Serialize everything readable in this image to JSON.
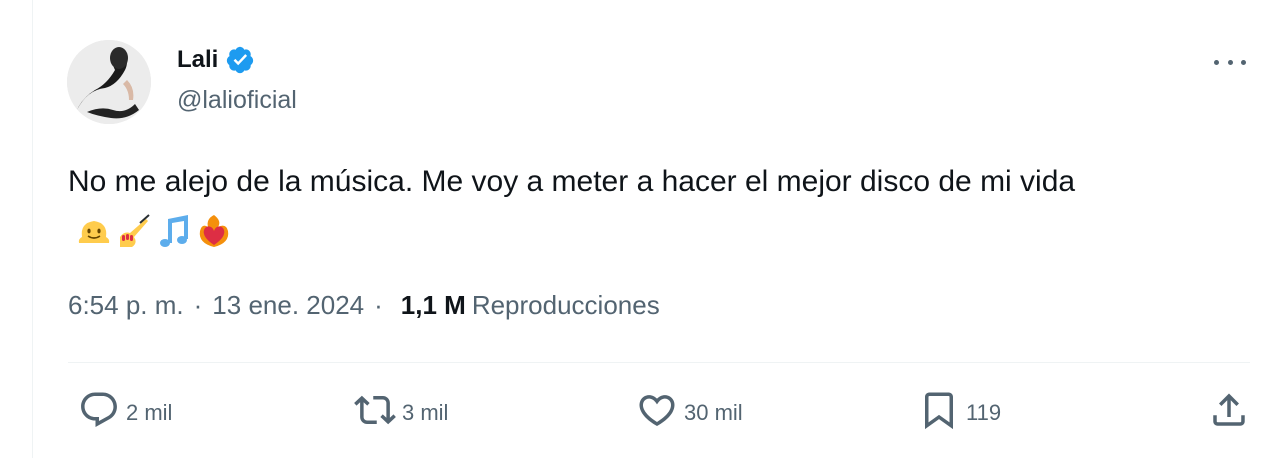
{
  "author": {
    "display_name": "Lali",
    "handle": "@lalioficial",
    "verified": true
  },
  "tweet": {
    "text": "No me alejo de la música. Me voy a meter a hacer el mejor disco de mi vida",
    "emojis": [
      "melting-face-emoji",
      "nail-polish-emoji",
      "musical-notes-emoji",
      "heart-on-fire-emoji"
    ],
    "time": "6:54 p. m.",
    "separator": "·",
    "date": "13 ene. 2024",
    "views_count": "1,1 M",
    "views_label": "Reproducciones"
  },
  "actions": {
    "replies": "2 mil",
    "reposts": "3 mil",
    "likes": "30 mil",
    "bookmarks": "119"
  },
  "colors": {
    "verified_blue": "#1d9bf0",
    "secondary_text": "#536471",
    "primary_text": "#0f1419"
  }
}
